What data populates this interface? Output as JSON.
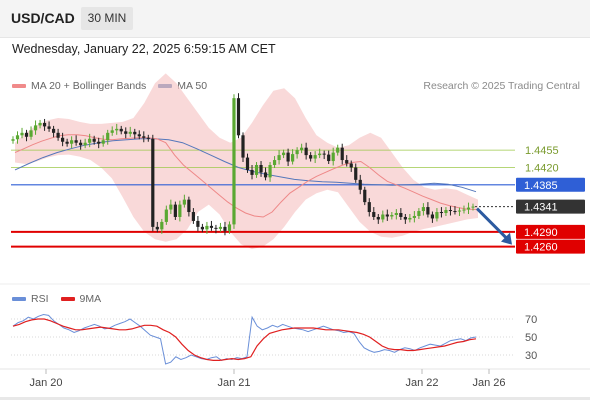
{
  "header": {
    "symbol": "USD/CAD",
    "timeframe": "30 MIN"
  },
  "timestamp": "Wednesday, January 22, 2025 6:59:15 AM CET",
  "legend": {
    "ma20_label": "MA 20 + Bollinger Bands",
    "ma20_color": "#f08a8a",
    "ma50_label": "MA 50",
    "ma50_color": "#2c5aa0"
  },
  "research_label": "Research © 2025 Trading Central",
  "rsi_legend": {
    "rsi_label": "RSI",
    "rsi_color": "#6a8fd8",
    "ma9_label": "9MA",
    "ma9_color": "#e02020"
  },
  "chart_data": [
    {
      "type": "candlestick",
      "title": "USD/CAD 30 MIN",
      "ylim": [
        1.4225,
        1.4625
      ],
      "x": [
        "Jan 20",
        "Jan 21",
        "Jan 22",
        "Jan 26"
      ],
      "levels": [
        {
          "value": 1.4455,
          "label": "1.4455",
          "kind": "resistance",
          "color": "#9cc84a"
        },
        {
          "value": 1.442,
          "label": "1.4420",
          "kind": "resistance",
          "color": "#9cc84a"
        },
        {
          "value": 1.4385,
          "label": "1.4385",
          "kind": "pivot",
          "color": "#2f5fd6"
        },
        {
          "value": 1.429,
          "label": "1.4290",
          "kind": "support",
          "color": "#e00000"
        },
        {
          "value": 1.426,
          "label": "1.4260",
          "kind": "support",
          "color": "#e00000"
        }
      ],
      "last_price": {
        "value": 1.4341,
        "label": "1.4341"
      },
      "forecast_arrow": {
        "from": 1.4341,
        "to": 1.426,
        "direction": "down",
        "color": "#2c5aa0"
      },
      "series": [
        {
          "name": "Price",
          "closes": [
            1.4477,
            1.4485,
            1.449,
            1.4482,
            1.4495,
            1.4505,
            1.451,
            1.4503,
            1.4498,
            1.449,
            1.448,
            1.4472,
            1.4468,
            1.4475,
            1.447,
            1.4465,
            1.447,
            1.4478,
            1.4472,
            1.4468,
            1.4475,
            1.449,
            1.4495,
            1.4498,
            1.4493,
            1.4488,
            1.4492,
            1.4487,
            1.4483,
            1.448,
            1.4478,
            1.43,
            1.4295,
            1.431,
            1.4335,
            1.4345,
            1.432,
            1.4345,
            1.4355,
            1.433,
            1.4312,
            1.43,
            1.4295,
            1.4302,
            1.4298,
            1.4296,
            1.43,
            1.4292,
            1.4305,
            1.456,
            1.4485,
            1.444,
            1.4415,
            1.4405,
            1.4425,
            1.441,
            1.44,
            1.4425,
            1.4435,
            1.4445,
            1.445,
            1.4432,
            1.4447,
            1.4455,
            1.446,
            1.4445,
            1.4438,
            1.4445,
            1.4448,
            1.4446,
            1.4433,
            1.445,
            1.446,
            1.4435,
            1.4428,
            1.442,
            1.4395,
            1.4375,
            1.435,
            1.433,
            1.432,
            1.4315,
            1.4325,
            1.4321,
            1.4324,
            1.4328,
            1.432,
            1.4315,
            1.4318,
            1.4322,
            1.4332,
            1.434,
            1.4325,
            1.4317,
            1.433,
            1.4328,
            1.4334,
            1.4332,
            1.4331,
            1.4333,
            1.4335,
            1.4339,
            1.4341
          ]
        },
        {
          "name": "MA 20",
          "values": [
            1.445,
            1.4458,
            1.4466,
            1.4473,
            1.4479,
            1.4484,
            1.4486,
            1.4486,
            1.4484,
            1.448,
            1.4477,
            1.4476,
            1.4478,
            1.4479,
            1.448,
            1.448,
            1.4478,
            1.447,
            1.4445,
            1.4425,
            1.441,
            1.4395,
            1.438,
            1.4365,
            1.435,
            1.4338,
            1.4328,
            1.4322,
            1.432,
            1.433,
            1.435,
            1.4368,
            1.438,
            1.4392,
            1.4402,
            1.441,
            1.4418,
            1.4425,
            1.443,
            1.4432,
            1.442,
            1.4405,
            1.4392,
            1.4385,
            1.4378,
            1.437,
            1.4362,
            1.4355,
            1.4348,
            1.4343,
            1.4339,
            1.4336,
            1.4335
          ]
        },
        {
          "name": "MA 50",
          "values": [
            1.4415,
            1.4428,
            1.444,
            1.445,
            1.4458,
            1.4465,
            1.447,
            1.4474,
            1.4476,
            1.4478,
            1.4478,
            1.4476,
            1.447,
            1.4458,
            1.4445,
            1.4432,
            1.442,
            1.4412,
            1.4406,
            1.4401,
            1.4396,
            1.4393,
            1.4391,
            1.439,
            1.4388,
            1.4386,
            1.4385,
            1.4384,
            1.4385,
            1.4386,
            1.4388,
            1.4386,
            1.438,
            1.4371
          ]
        },
        {
          "name": "Bollinger Upper",
          "values": [
            1.447,
            1.449,
            1.4505,
            1.4515,
            1.452,
            1.4518,
            1.4512,
            1.4508,
            1.4508,
            1.451,
            1.4512,
            1.452,
            1.455,
            1.459,
            1.461,
            1.459,
            1.456,
            1.453,
            1.45,
            1.448,
            1.447,
            1.448,
            1.451,
            1.4545,
            1.4575,
            1.458,
            1.456,
            1.452,
            1.4485,
            1.447,
            1.446,
            1.4465,
            1.448,
            1.449,
            1.448,
            1.445,
            1.442,
            1.4395,
            1.438,
            1.4375,
            1.4378,
            1.4375,
            1.4365,
            1.4355
          ]
        },
        {
          "name": "Bollinger Lower",
          "values": [
            1.443,
            1.4427,
            1.4432,
            1.444,
            1.4445,
            1.4446,
            1.4442,
            1.4435,
            1.442,
            1.4398,
            1.436,
            1.432,
            1.429,
            1.4275,
            1.427,
            1.4275,
            1.4295,
            1.433,
            1.4345,
            1.4325,
            1.429,
            1.4265,
            1.4255,
            1.426,
            1.4275,
            1.43,
            1.433,
            1.4355,
            1.4368,
            1.4375,
            1.437,
            1.434,
            1.431,
            1.429,
            1.428,
            1.4278,
            1.4282,
            1.429,
            1.4296,
            1.43,
            1.4305,
            1.431,
            1.4315,
            1.4318
          ]
        }
      ]
    },
    {
      "type": "line",
      "title": "RSI",
      "ylim": [
        20,
        80
      ],
      "yticks": [
        "70",
        "50",
        "30"
      ],
      "series": [
        {
          "name": "RSI",
          "values": [
            62,
            66,
            68,
            72,
            70,
            73,
            75,
            74,
            68,
            64,
            60,
            58,
            55,
            57,
            60,
            62,
            64,
            62,
            59,
            60,
            63,
            65,
            67,
            70,
            66,
            62,
            57,
            52,
            50,
            48,
            20,
            22,
            28,
            25,
            27,
            30,
            28,
            26,
            25,
            27,
            28,
            24,
            26,
            25,
            27,
            26,
            28,
            72,
            62,
            58,
            60,
            63,
            61,
            64,
            62,
            60,
            59,
            58,
            56,
            58,
            60,
            62,
            60,
            58,
            57,
            55,
            56,
            54,
            45,
            38,
            35,
            33,
            34,
            36,
            35,
            33,
            36,
            38,
            37,
            35,
            38,
            40,
            42,
            41,
            40,
            43,
            46,
            47,
            48,
            46,
            49,
            50
          ]
        },
        {
          "name": "9MA",
          "values": [
            62,
            64,
            67,
            69,
            70,
            70,
            68,
            65,
            62,
            60,
            58,
            58,
            59,
            60,
            61,
            60,
            59,
            58,
            58,
            59,
            61,
            63,
            63,
            62,
            58,
            55,
            50,
            42,
            35,
            30,
            27,
            25,
            24,
            24,
            25,
            26,
            25,
            26,
            28,
            40,
            48,
            54,
            56,
            58,
            59,
            60,
            60,
            60,
            60,
            59,
            58,
            58,
            58,
            57,
            56,
            55,
            53,
            50,
            45,
            40,
            37,
            36,
            36,
            35,
            35,
            36,
            37,
            38,
            39,
            40,
            42,
            44,
            45,
            47,
            48
          ]
        }
      ]
    }
  ]
}
